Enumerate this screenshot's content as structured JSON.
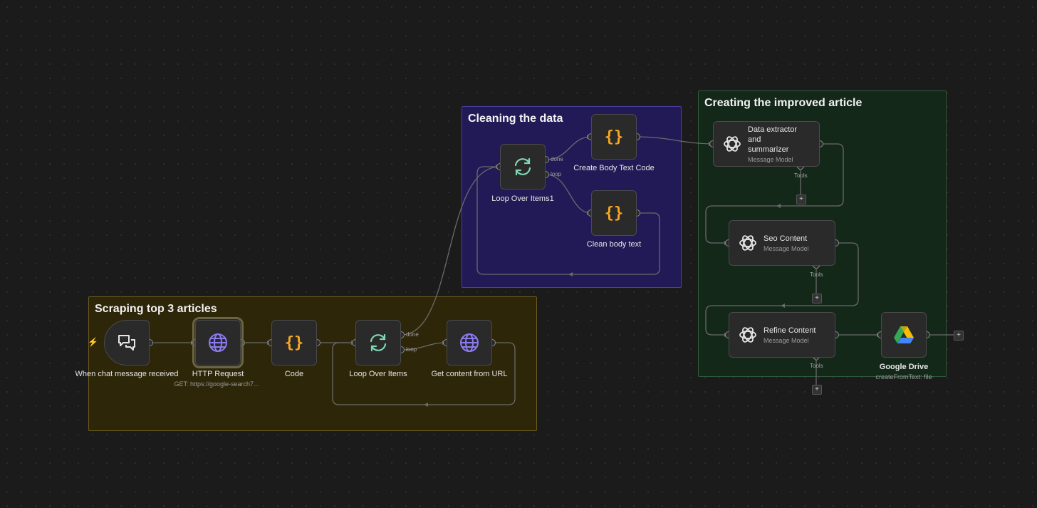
{
  "groups": {
    "scraping": "Scraping top 3 articles",
    "cleaning": "Cleaning the data",
    "creating": "Creating the improved article"
  },
  "nodes": {
    "chat_trigger": {
      "label": "When chat message received",
      "icon": "chat-icon"
    },
    "http_request": {
      "label": "HTTP Request",
      "sublabel": "GET: https://google-search7...",
      "icon": "globe-icon"
    },
    "code": {
      "label": "Code",
      "icon": "braces-icon"
    },
    "loop_over_items": {
      "label": "Loop Over Items",
      "icon": "loop-icon"
    },
    "get_content": {
      "label": "Get content from URL",
      "icon": "globe-icon"
    },
    "loop_over_items1": {
      "label": "Loop Over Items1",
      "icon": "loop-icon"
    },
    "create_body_text": {
      "label": "Create Body Text Code",
      "icon": "braces-icon"
    },
    "clean_body_text": {
      "label": "Clean body text",
      "icon": "braces-icon"
    },
    "data_extractor": {
      "title": "Data extractor and summarizer",
      "subtitle": "Message Model",
      "icon": "openai-icon"
    },
    "seo_content": {
      "title": "Seo Content",
      "subtitle": "Message Model",
      "icon": "openai-icon"
    },
    "refine_content": {
      "title": "Refine Content",
      "subtitle": "Message Model",
      "icon": "openai-icon"
    },
    "google_drive": {
      "label": "Google Drive",
      "sublabel": "createFromText: file",
      "icon": "google-drive-icon"
    }
  },
  "ports": {
    "done": "done",
    "loop": "loop",
    "tools": "Tools"
  },
  "colors": {
    "code": "#f5a623",
    "globe": "#8b7bf0",
    "loop": "#7fd6b4",
    "trigger_bolt": "#ff6d3b"
  }
}
